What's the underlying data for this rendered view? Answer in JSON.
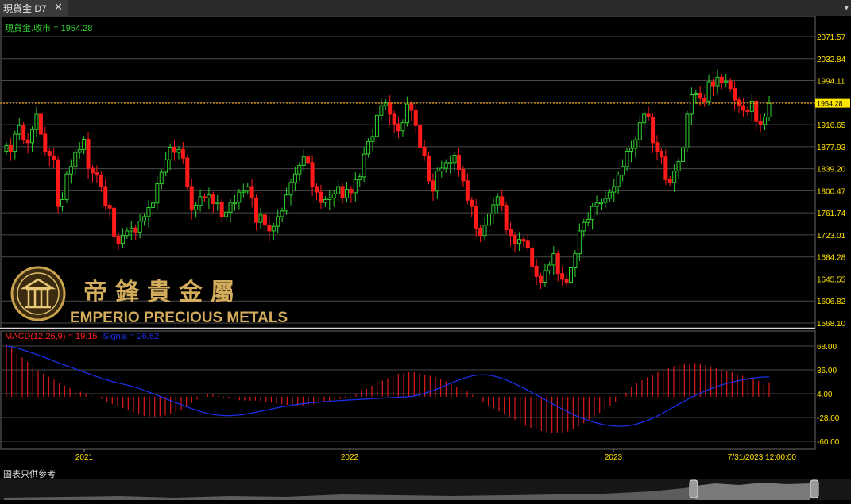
{
  "tab": {
    "title": "現貨金 D7",
    "close_glyph": "✕",
    "menu_glyph": "▾"
  },
  "brand": {
    "chinese_name": "帝鋒貴金屬",
    "english_name": "EMPERIO PRECIOUS METALS"
  },
  "price_panel": {
    "label": "現貨金.收市 = 1954.28",
    "last_price": "1954.28"
  },
  "macd_panel": {
    "label_macd": "MACD(12,26,9) = 19.15",
    "label_signal": "Signal = 26.52"
  },
  "footer": {
    "note": "圖表只供參考"
  },
  "colors": {
    "up": "#2fd12f",
    "down": "#ff1a1a",
    "grid": "#4a4a4a",
    "axis_text": "#ffe100",
    "signal": "#1a2fe6",
    "macd_hist": "#e01a1a",
    "price_line": "#ffa500"
  },
  "chart_data": [
    {
      "type": "candlestick",
      "title": "現貨金.收市 = 1954.28",
      "ylim": [
        1568.1,
        2071.57
      ],
      "yticks": [
        2071.57,
        2032.84,
        1994.11,
        1955.38,
        1916.65,
        1877.93,
        1839.2,
        1800.47,
        1761.74,
        1723.01,
        1684.28,
        1645.55,
        1606.82,
        1568.1
      ],
      "xticks": [
        "2021",
        "2022",
        "2023",
        "7/31/2023 12:00:00"
      ],
      "grid": true,
      "last": 1954.28,
      "close": [
        1880,
        1870,
        1900,
        1915,
        1890,
        1885,
        1908,
        1935,
        1900,
        1870,
        1862,
        1855,
        1773,
        1785,
        1830,
        1843,
        1868,
        1873,
        1891,
        1840,
        1832,
        1828,
        1808,
        1775,
        1770,
        1721,
        1708,
        1722,
        1730,
        1735,
        1728,
        1747,
        1755,
        1771,
        1779,
        1813,
        1833,
        1855,
        1877,
        1868,
        1873,
        1858,
        1808,
        1767,
        1775,
        1790,
        1788,
        1793,
        1778,
        1780,
        1755,
        1763,
        1780,
        1780,
        1798,
        1800,
        1808,
        1788,
        1745,
        1758,
        1740,
        1730,
        1738,
        1755,
        1765,
        1793,
        1815,
        1830,
        1845,
        1860,
        1850,
        1808,
        1798,
        1780,
        1785,
        1788,
        1795,
        1808,
        1788,
        1803,
        1797,
        1820,
        1825,
        1865,
        1887,
        1896,
        1933,
        1950,
        1955,
        1935,
        1918,
        1906,
        1920,
        1953,
        1942,
        1915,
        1877,
        1862,
        1818,
        1800,
        1835,
        1840,
        1850,
        1850,
        1863,
        1838,
        1818,
        1784,
        1773,
        1735,
        1722,
        1740,
        1760,
        1776,
        1790,
        1775,
        1732,
        1722,
        1708,
        1715,
        1712,
        1700,
        1668,
        1650,
        1640,
        1660,
        1670,
        1690,
        1655,
        1645,
        1640,
        1665,
        1690,
        1730,
        1745,
        1750,
        1773,
        1779,
        1780,
        1787,
        1798,
        1808,
        1828,
        1843,
        1870,
        1875,
        1890,
        1920,
        1935,
        1930,
        1885,
        1870,
        1860,
        1820,
        1815,
        1835,
        1852,
        1876,
        1935,
        1969,
        1972,
        1963,
        1958,
        1992,
        1985,
        2000,
        1991,
        1993,
        1980,
        1960,
        1950,
        1942,
        1940,
        1958,
        1922,
        1917,
        1930,
        1954
      ]
    },
    {
      "type": "bar+line",
      "title": "MACD(12,26,9) = 19.15",
      "series": [
        {
          "name": "MACD(12,26,9)",
          "style": "histogram",
          "values": [
            70.0,
            66.1,
            58.2,
            52.7,
            46.8,
            40.8,
            35.0,
            30.7,
            26.9,
            22.7,
            18.4,
            14.8,
            11.6,
            8.7,
            6.7,
            4.2,
            2.4,
            0.2,
            -2.8,
            -6.5,
            -9.9,
            -12.8,
            -15.3,
            -18.2,
            -21.0,
            -23.5,
            -25.6,
            -27.0,
            -26.8,
            -26.4,
            -25.3,
            -23.7,
            -20.8,
            -17.3,
            -12.9,
            -8.3,
            -4.0,
            0.3,
            3.2,
            2.9,
            1.2,
            -0.9,
            -2.6,
            -3.8,
            -4.9,
            -5.1,
            -5.5,
            -5.3,
            -6.0,
            -7.5,
            -8.1,
            -9.2,
            -10.0,
            -11.2,
            -12.0,
            -12.3,
            -11.9,
            -11.1,
            -10.1,
            -8.4,
            -6.9,
            -6.1,
            -4.6,
            -3.2,
            -1.4,
            0.8,
            3.6,
            7.2,
            10.8,
            14.6,
            18.0,
            21.5,
            24.8,
            28.7,
            30.7,
            31.3,
            32.8,
            32.6,
            31.2,
            29.2,
            27.9,
            26.2,
            23.9,
            20.8,
            16.8,
            12.9,
            9.6,
            6.9,
            2.3,
            -2.5,
            -7.1,
            -11.9,
            -16.0,
            -19.8,
            -23.6,
            -27.9,
            -31.5,
            -35.3,
            -39.1,
            -41.9,
            -44.1,
            -46.2,
            -47.8,
            -48.6,
            -49.3,
            -48.5,
            -46.7,
            -44.1,
            -40.6,
            -35.9,
            -30.9,
            -26.6,
            -21.8,
            -16.5,
            -11.7,
            -7.3,
            -1.2,
            5.3,
            12.8,
            17.9,
            22.1,
            26.0,
            29.4,
            32.8,
            35.7,
            38.3,
            40.8,
            42.8,
            43.6,
            44.4,
            45.2,
            43.6,
            42.0,
            40.1,
            38.2,
            36.3,
            34.5,
            32.6,
            30.4,
            28.0,
            25.6,
            23.2,
            21.0,
            19.2,
            19.15
          ]
        },
        {
          "name": "Signal",
          "style": "line",
          "values": [
            68.0,
            66.9,
            65.2,
            63.0,
            60.7,
            58.3,
            55.8,
            53.1,
            50.3,
            47.4,
            44.6,
            41.9,
            39.4,
            36.9,
            34.3,
            31.7,
            29.1,
            26.5,
            24.1,
            21.8,
            19.7,
            18.1,
            16.4,
            14.7,
            12.7,
            10.3,
            7.6,
            5.0,
            2.2,
            -0.8,
            -3.8,
            -6.6,
            -9.4,
            -12.1,
            -14.7,
            -17.2,
            -19.5,
            -21.6,
            -23.3,
            -24.4,
            -25.2,
            -25.5,
            -25.3,
            -24.8,
            -24.0,
            -22.9,
            -21.6,
            -20.0,
            -18.5,
            -17.0,
            -15.5,
            -14.1,
            -12.8,
            -11.6,
            -10.5,
            -9.6,
            -8.8,
            -8.1,
            -7.4,
            -6.8,
            -6.2,
            -5.7,
            -5.2,
            -4.8,
            -4.4,
            -4.0,
            -3.6,
            -3.2,
            -2.8,
            -2.4,
            -2.0,
            -1.6,
            -1.2,
            -0.8,
            -0.4,
            0.0,
            1.0,
            2.6,
            4.7,
            7.1,
            9.8,
            12.7,
            15.8,
            18.8,
            21.7,
            24.3,
            26.5,
            28.2,
            29.2,
            29.4,
            28.8,
            27.3,
            25.2,
            22.6,
            19.5,
            16.1,
            12.5,
            8.8,
            4.9,
            1.0,
            -3.0,
            -7.0,
            -10.9,
            -14.8,
            -18.5,
            -22.1,
            -25.4,
            -28.4,
            -31.1,
            -33.5,
            -35.6,
            -37.3,
            -38.6,
            -39.4,
            -39.8,
            -39.6,
            -38.8,
            -37.4,
            -35.4,
            -32.9,
            -30.0,
            -26.6,
            -22.9,
            -19.0,
            -14.9,
            -10.9,
            -6.9,
            -3.0,
            0.7,
            4.2,
            7.4,
            10.4,
            13.0,
            15.4,
            17.5,
            19.4,
            21.1,
            22.6,
            23.9,
            25.0,
            25.9,
            26.4,
            26.52
          ]
        }
      ],
      "ylim": [
        -60,
        68
      ],
      "yticks": [
        68.0,
        36.0,
        4.0,
        -28.0,
        -60.0
      ],
      "xticks": [
        "2021",
        "2022",
        "2023",
        "7/31/2023 12:00:00"
      ],
      "grid": true
    }
  ]
}
